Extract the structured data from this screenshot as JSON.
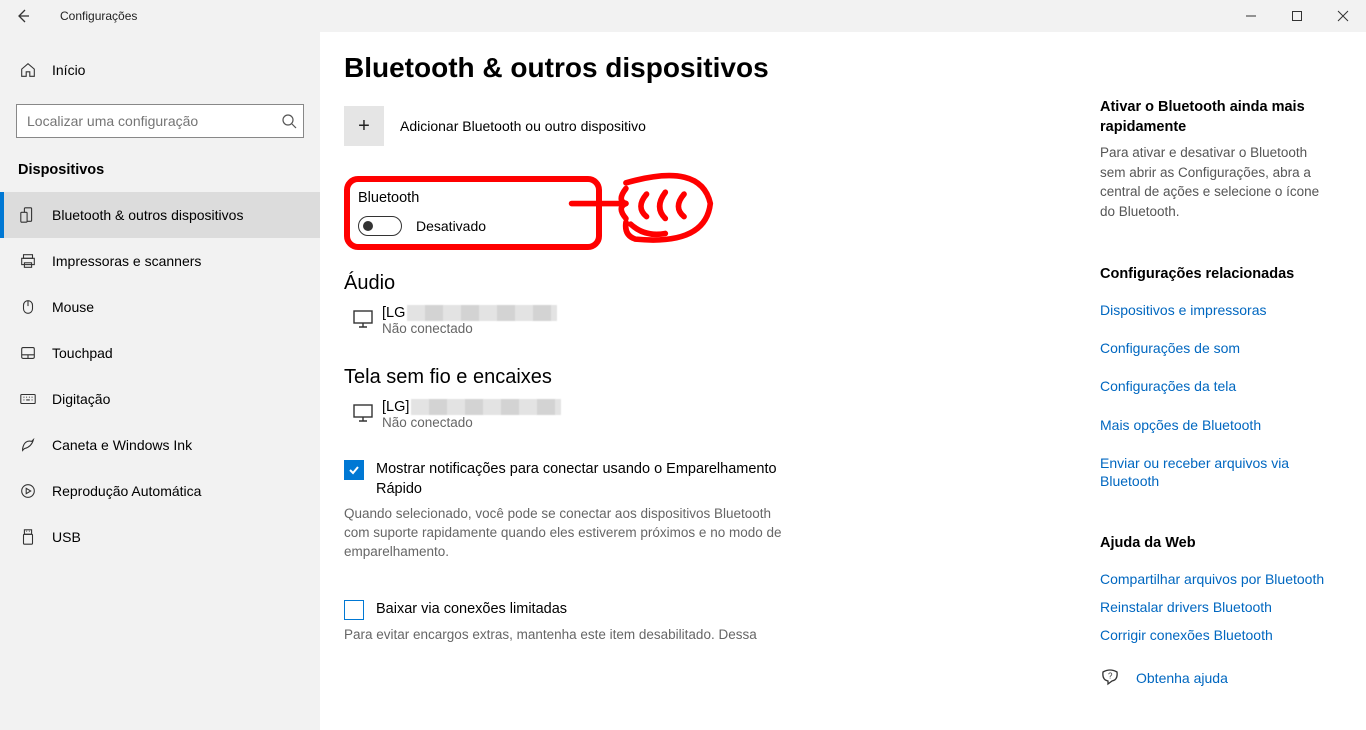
{
  "window": {
    "title": "Configurações"
  },
  "sidebar": {
    "home": "Início",
    "search_placeholder": "Localizar uma configuração",
    "heading": "Dispositivos",
    "items": [
      {
        "label": "Bluetooth & outros dispositivos"
      },
      {
        "label": "Impressoras e scanners"
      },
      {
        "label": "Mouse"
      },
      {
        "label": "Touchpad"
      },
      {
        "label": "Digitação"
      },
      {
        "label": "Caneta e Windows Ink"
      },
      {
        "label": "Reprodução Automática"
      },
      {
        "label": "USB"
      }
    ]
  },
  "main": {
    "title": "Bluetooth & outros dispositivos",
    "add_label": "Adicionar Bluetooth ou outro dispositivo",
    "bluetooth": {
      "label": "Bluetooth",
      "status": "Desativado"
    },
    "audio": {
      "heading": "Áudio",
      "device": {
        "name": "[LG",
        "status": "Não conectado"
      }
    },
    "wireless": {
      "heading": "Tela sem fio e encaixes",
      "device": {
        "name": "[LG]",
        "status": "Não conectado"
      }
    },
    "quickpair": {
      "label": "Mostrar notificações para conectar usando o Emparelhamento Rápido",
      "desc": "Quando selecionado, você pode se conectar aos dispositivos Bluetooth com suporte rapidamente quando eles estiverem próximos e no modo de emparelhamento."
    },
    "limited": {
      "label": "Baixar via conexões limitadas",
      "desc": "Para evitar encargos extras, mantenha este item desabilitado. Dessa"
    }
  },
  "right": {
    "quick_title": "Ativar o Bluetooth ainda mais rapidamente",
    "quick_text": "Para ativar e desativar o Bluetooth sem abrir as Configurações, abra a central de ações e selecione o ícone do Bluetooth.",
    "related_heading": "Configurações relacionadas",
    "related_links": [
      "Dispositivos e impressoras",
      "Configurações de som",
      "Configurações da tela",
      "Mais opções de Bluetooth",
      "Enviar ou receber arquivos via Bluetooth"
    ],
    "help_heading": "Ajuda da Web",
    "help_links": [
      "Compartilhar arquivos por Bluetooth",
      "Reinstalar drivers Bluetooth",
      "Corrigir conexões Bluetooth"
    ],
    "get_help": "Obtenha ajuda"
  }
}
